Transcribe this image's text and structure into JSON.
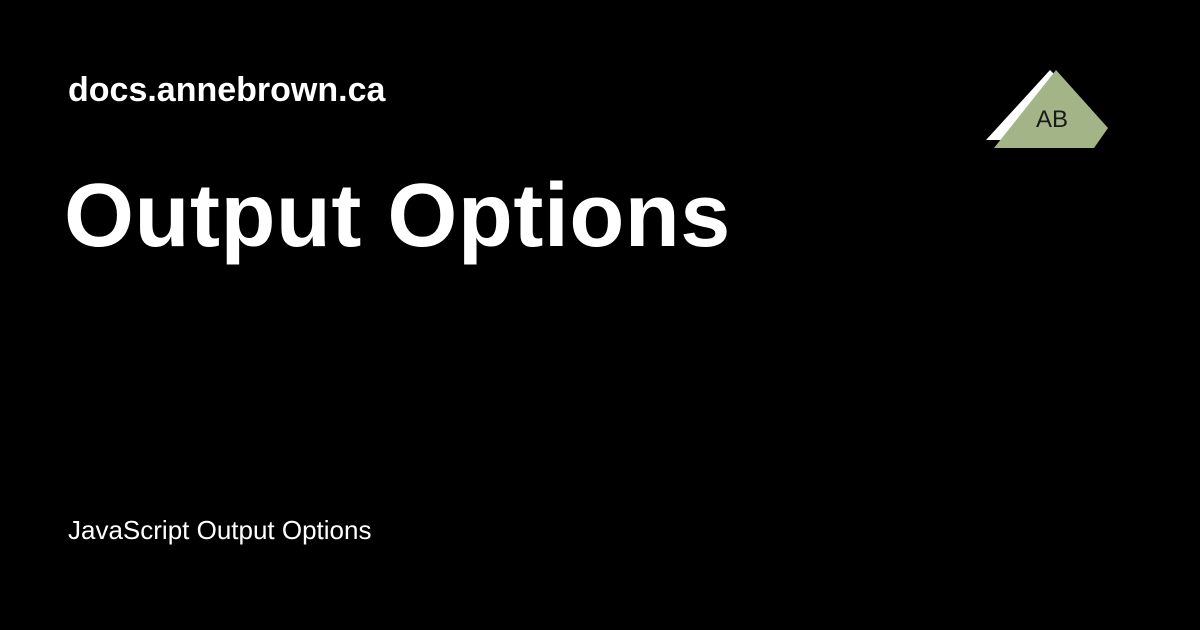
{
  "header": {
    "site_name": "docs.annebrown.ca",
    "logo_text": "AB"
  },
  "main": {
    "title": "Output Options",
    "description": "JavaScript Output Options"
  },
  "colors": {
    "background": "#000000",
    "text": "#ffffff",
    "logo_fill": "#a3b587",
    "logo_outline": "#ffffff",
    "logo_text": "#1a1a1a"
  }
}
